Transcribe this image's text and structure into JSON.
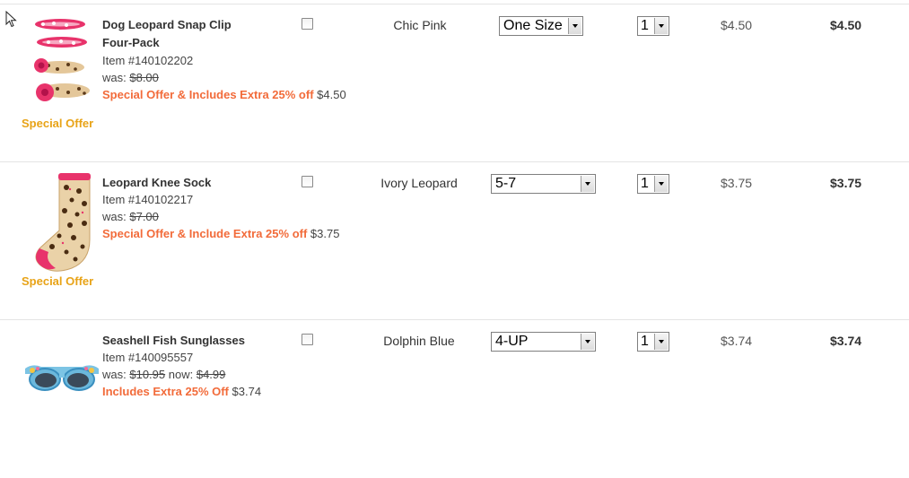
{
  "items": [
    {
      "name_line1": "Dog Leopard Snap Clip",
      "name_line2": "Four-Pack",
      "item_number": "Item #140102202",
      "was_label": "was:",
      "was_price": "$8.00",
      "offer_text": "Special Offer & Includes Extra 25% off",
      "offer_price": "$4.50",
      "badge": "Special Offer",
      "color": "Chic Pink",
      "size": "One Size",
      "qty": "1",
      "unit_price": "$4.50",
      "total_price": "$4.50"
    },
    {
      "name_line1": "Leopard Knee Sock",
      "item_number": "Item #140102217",
      "was_label": "was:",
      "was_price": "$7.00",
      "offer_text": "Special Offer & Include Extra 25% off",
      "offer_price": "$3.75",
      "badge": "Special Offer",
      "color": "Ivory Leopard",
      "size": "5-7",
      "qty": "1",
      "unit_price": "$3.75",
      "total_price": "$3.75"
    },
    {
      "name_line1": "Seashell Fish Sunglasses",
      "item_number": "Item #140095557",
      "was_label": "was:",
      "was_price": "$10.95",
      "now_label": "now:",
      "now_price": "$4.99",
      "offer_text": "Includes Extra 25% Off",
      "offer_price": "$3.74",
      "color": "Dolphin Blue",
      "size": "4-UP",
      "qty": "1",
      "unit_price": "$3.74",
      "total_price": "$3.74"
    }
  ],
  "colors": {
    "offer": "#f26b3a",
    "badge": "#e8a317",
    "divider": "#e4e4e4"
  },
  "icons": [
    "mouse-cursor-icon",
    "hair-clips-image",
    "knee-sock-image",
    "sunglasses-image",
    "chevron-down-icon"
  ]
}
